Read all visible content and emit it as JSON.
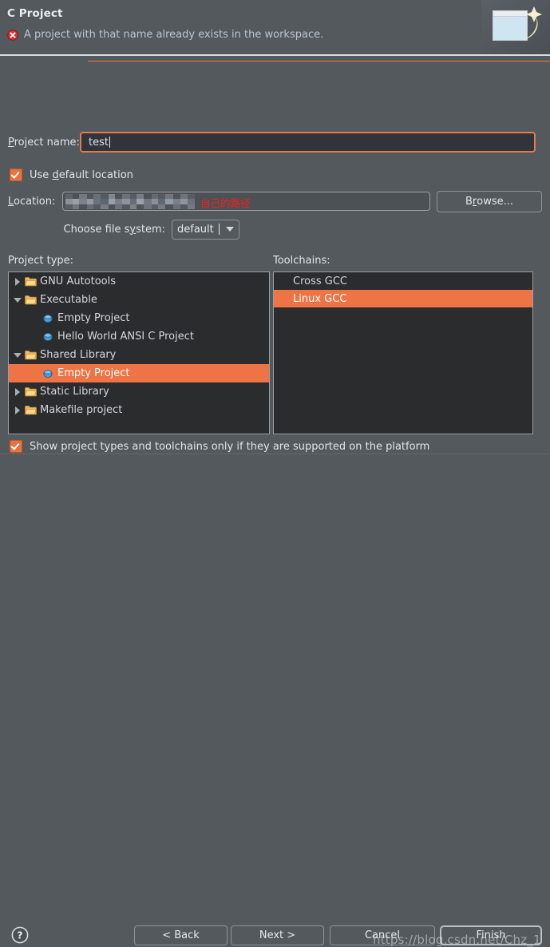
{
  "header": {
    "title": "C Project",
    "error_icon": "error-circle-icon",
    "message": "A project with that name already exists in the workspace.",
    "banner_icon": "new-project-wizard-banner-icon"
  },
  "form": {
    "project_name_label": "Project name:",
    "project_name_value": "test",
    "use_default_location_label_pre": "Use ",
    "use_default_location_label_key": "d",
    "use_default_location_label_post": "efault location",
    "use_default_location_checked": true,
    "location_label": "Location:",
    "location_value_masked": "",
    "location_annotation": "自己的路径",
    "browse_label": "Browse...",
    "file_system_label": "Choose file system:",
    "file_system_value": "default",
    "file_system_options": [
      "default"
    ]
  },
  "project_type": {
    "label": "Project type:",
    "items": [
      {
        "label": "GNU Autotools",
        "depth": 1,
        "icon": "folder-icon",
        "twisty": "collapsed",
        "selected": false
      },
      {
        "label": "Executable",
        "depth": 1,
        "icon": "folder-icon",
        "twisty": "expanded",
        "selected": false
      },
      {
        "label": "Empty Project",
        "depth": 2,
        "icon": "project-node-icon",
        "twisty": "none",
        "selected": false
      },
      {
        "label": "Hello World ANSI C Project",
        "depth": 2,
        "icon": "project-node-icon",
        "twisty": "none",
        "selected": false
      },
      {
        "label": "Shared Library",
        "depth": 1,
        "icon": "folder-icon",
        "twisty": "expanded",
        "selected": false
      },
      {
        "label": "Empty Project",
        "depth": 2,
        "icon": "project-node-icon",
        "twisty": "none",
        "selected": true
      },
      {
        "label": "Static Library",
        "depth": 1,
        "icon": "folder-icon",
        "twisty": "collapsed",
        "selected": false
      },
      {
        "label": "Makefile project",
        "depth": 1,
        "icon": "folder-icon",
        "twisty": "collapsed",
        "selected": false
      }
    ]
  },
  "toolchains": {
    "label": "Toolchains:",
    "items": [
      {
        "label": "Cross GCC",
        "selected": false
      },
      {
        "label": "Linux GCC",
        "selected": true
      }
    ]
  },
  "options": {
    "show_supported_label": "Show project types and toolchains only if they are supported on the platform",
    "show_supported_checked": true
  },
  "buttons": {
    "help_icon": "help-question-icon",
    "back": "< Back",
    "next": "Next >",
    "cancel": "Cancel",
    "finish": "Finish"
  },
  "watermark": {
    "text": "https://blog.csdn.net/Chz_1"
  },
  "colors": {
    "window_background": "#54595d",
    "panel_background": "#2b2c2e",
    "selection": "#ef7445",
    "accent_border": "#e07b52",
    "error_red": "#d9302c",
    "annotation_red": "#fc1d1d",
    "text": "#dfe4e8"
  }
}
